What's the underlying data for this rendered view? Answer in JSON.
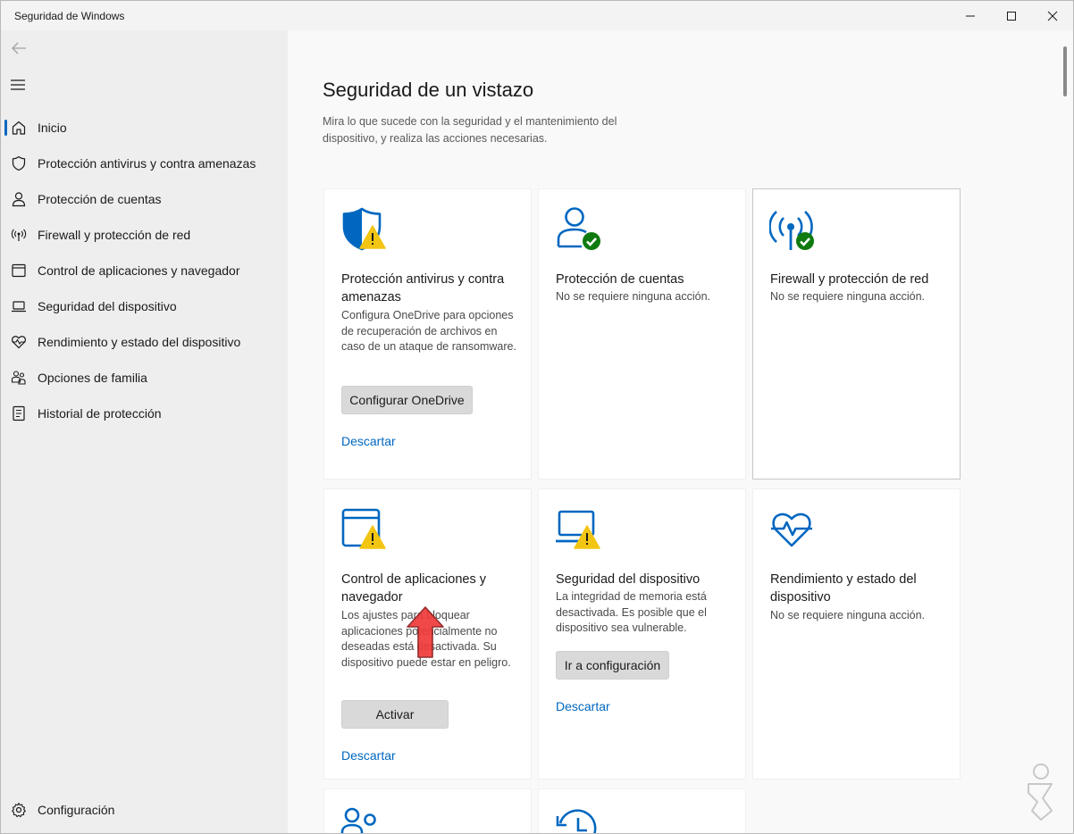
{
  "window": {
    "title": "Seguridad de Windows",
    "accent": "#0067c0",
    "warning_color": "#f2c512",
    "ok_color": "#0f7b0f"
  },
  "sidebar": {
    "items": [
      {
        "label": "Inicio",
        "icon": "home-icon",
        "selected": true
      },
      {
        "label": "Protección antivirus y contra amenazas",
        "icon": "shield-icon"
      },
      {
        "label": "Protección de cuentas",
        "icon": "person-icon"
      },
      {
        "label": "Firewall y protección de red",
        "icon": "wifi-antenna-icon"
      },
      {
        "label": "Control de aplicaciones y navegador",
        "icon": "app-window-icon"
      },
      {
        "label": "Seguridad del dispositivo",
        "icon": "laptop-icon"
      },
      {
        "label": "Rendimiento y estado del dispositivo",
        "icon": "heart-pulse-icon"
      },
      {
        "label": "Opciones de familia",
        "icon": "family-icon"
      },
      {
        "label": "Historial de protección",
        "icon": "history-icon"
      }
    ],
    "settings": {
      "label": "Configuración",
      "icon": "gear-icon"
    }
  },
  "main": {
    "title": "Seguridad de un vistazo",
    "subtitle": "Mira lo que sucede con la seguridad y el mantenimiento del dispositivo, y realiza las acciones necesarias.",
    "cards": [
      {
        "title": "Protección antivirus y contra amenazas",
        "desc": "Configura OneDrive para opciones de recuperación de archivos en caso de un ataque de ransomware.",
        "button": "Configurar OneDrive",
        "link": "Descartar",
        "status": "warning"
      },
      {
        "title": "Protección de cuentas",
        "desc": "No se requiere ninguna acción.",
        "status": "ok"
      },
      {
        "title": "Firewall y protección de red",
        "desc": "No se requiere ninguna acción.",
        "status": "ok"
      },
      {
        "title": "Control de aplicaciones y navegador",
        "desc": "Los ajustes para bloquear aplicaciones potencialmente no deseadas está desactivada. Su dispositivo puede estar en peligro.",
        "button": "Activar",
        "link": "Descartar",
        "status": "warning"
      },
      {
        "title": "Seguridad del dispositivo",
        "desc": "La integridad de memoria está desactivada. Es posible que el dispositivo sea vulnerable.",
        "button": "Ir a configuración",
        "link": "Descartar",
        "status": "warning"
      },
      {
        "title": "Rendimiento y estado del dispositivo",
        "desc": "No se requiere ninguna acción.",
        "status": "none"
      }
    ]
  }
}
